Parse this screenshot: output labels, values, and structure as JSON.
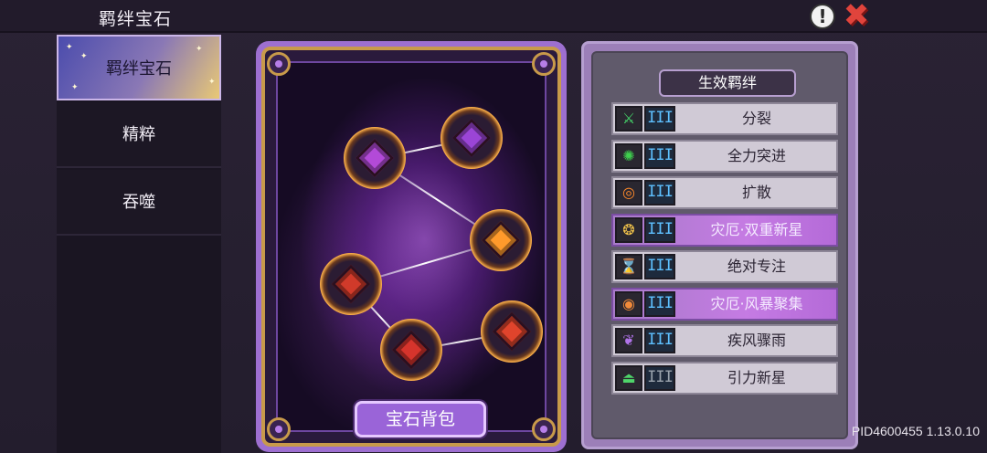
{
  "header": {
    "title": "羁绊宝石"
  },
  "sidebar": {
    "tabs": [
      {
        "label": "羁绊宝石",
        "active": true
      },
      {
        "label": "精粹",
        "active": false
      },
      {
        "label": "吞噬",
        "active": false
      }
    ]
  },
  "gem_card": {
    "bag_button_label": "宝石背包",
    "gems": [
      {
        "name": "purple-burst-gem",
        "color": "#b34ad8"
      },
      {
        "name": "purple-swirl-gem",
        "color": "#9b45d6"
      },
      {
        "name": "orange-ring-gem",
        "color": "#ff9a2b"
      },
      {
        "name": "red-tornado-gem",
        "color": "#d13a2a"
      },
      {
        "name": "red-square-gem",
        "color": "#e0442c"
      },
      {
        "name": "green-dash-gem",
        "color": "#d6342c"
      }
    ]
  },
  "bond_panel": {
    "title": "生效羁绊",
    "bonds": [
      {
        "label": "分裂",
        "icon": "split-icon",
        "icon_glyph": "⚔",
        "icon_color": "#45d86a",
        "level": "III",
        "active": true,
        "highlight": false
      },
      {
        "label": "全力突进",
        "icon": "dash-icon",
        "icon_glyph": "✺",
        "icon_color": "#3fd04e",
        "level": "III",
        "active": true,
        "highlight": false
      },
      {
        "label": "扩散",
        "icon": "diffuse-icon",
        "icon_glyph": "◎",
        "icon_color": "#ff8a2a",
        "level": "III",
        "active": true,
        "highlight": false
      },
      {
        "label": "灾厄·双重新星",
        "icon": "double-nova-icon",
        "icon_glyph": "❂",
        "icon_color": "#f2c34a",
        "level": "III",
        "active": true,
        "highlight": true
      },
      {
        "label": "绝对专注",
        "icon": "hourglass-icon",
        "icon_glyph": "⌛",
        "icon_color": "#e8a845",
        "level": "III",
        "active": true,
        "highlight": false
      },
      {
        "label": "灾厄·风暴聚集",
        "icon": "storm-gather-icon",
        "icon_glyph": "◉",
        "icon_color": "#f08a3a",
        "level": "III",
        "active": true,
        "highlight": true
      },
      {
        "label": "疾风骤雨",
        "icon": "whirlwind-icon",
        "icon_glyph": "❦",
        "icon_color": "#b073e8",
        "level": "III",
        "active": true,
        "highlight": false
      },
      {
        "label": "引力新星",
        "icon": "gravity-nova-icon",
        "icon_glyph": "⏏",
        "icon_color": "#4fd56a",
        "level": "III",
        "active": false,
        "highlight": false
      }
    ]
  },
  "footer": {
    "build_id": "PID4600455 1.13.0.10"
  }
}
